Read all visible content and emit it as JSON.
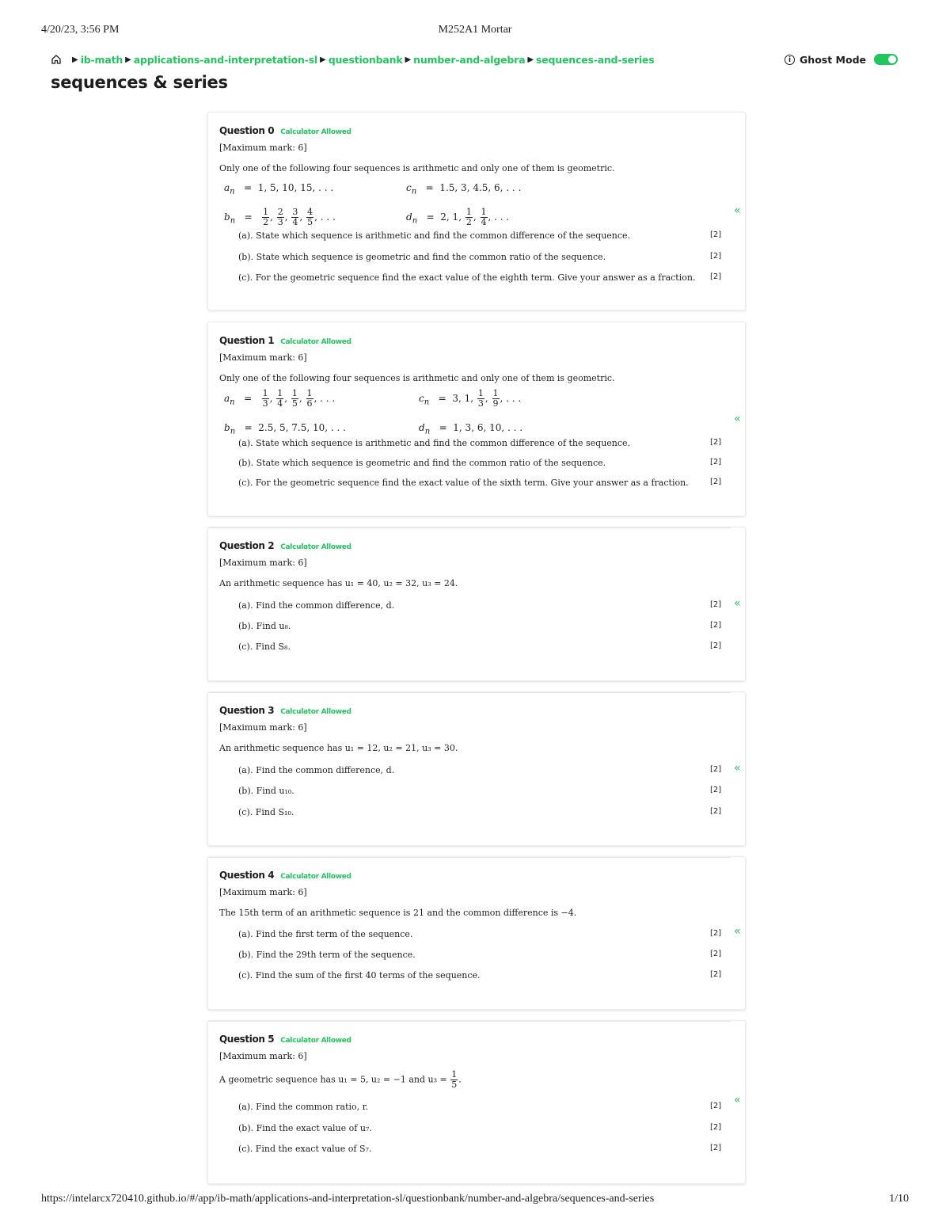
{
  "print": {
    "date": "4/20/23, 3:56 PM",
    "title": "M252A1 Mortar",
    "url": "https://intelarcx720410.github.io/#/app/ib-math/applications-and-interpretation-sl/questionbank/number-and-algebra/sequences-and-series",
    "page": "1/10"
  },
  "nav": {
    "breadcrumbs": [
      "ib-math",
      "applications-and-interpretation-sl",
      "questionbank",
      "number-and-algebra",
      "sequences-and-series"
    ],
    "ghost_label": "Ghost Mode",
    "ghost_on": true,
    "accent": "#22c55e"
  },
  "page_title": "sequences & series",
  "calc_label": "Calculator Allowed",
  "max_mark": "[Maximum mark: 6]",
  "flag_symbol": "[2]",
  "chevron": "«",
  "questions": [
    {
      "title": "Question 0",
      "stem": "Only one of the following four sequences is arithmetic and only one of them is geometric.",
      "parts": [
        "(a). State which sequence is arithmetic and find the common difference of the sequence.",
        "(b). State which sequence is geometric and find the common ratio of the sequence.",
        "(c). For the geometric sequence find the exact value of the eighth term. Give your answer as a fraction."
      ]
    },
    {
      "title": "Question 1",
      "stem": "Only one of the following four sequences is arithmetic and only one of them is geometric.",
      "parts": [
        "(a). State which sequence is arithmetic and find the common difference of the sequence.",
        "(b). State which sequence is geometric and find the common ratio of the sequence.",
        "(c). For the geometric sequence find the exact value of the sixth term. Give your answer as a fraction."
      ]
    },
    {
      "title": "Question 2",
      "stem": "An arithmetic sequence has u₁ = 40, u₂ = 32, u₃ = 24.",
      "parts": [
        "(a). Find the common difference, d.",
        "(b). Find u₈.",
        "(c). Find S₈."
      ]
    },
    {
      "title": "Question 3",
      "stem": "An arithmetic sequence has u₁ = 12, u₂ = 21, u₃ = 30.",
      "parts": [
        "(a). Find the common difference, d.",
        "(b). Find u₁₀.",
        "(c). Find S₁₀."
      ]
    },
    {
      "title": "Question 4",
      "stem": "The 15th term of an arithmetic sequence is 21 and the common difference is −4.",
      "parts": [
        "(a). Find the first term of the sequence.",
        "(b). Find the 29th term of the sequence.",
        "(c). Find the sum of the first 40 terms of the sequence."
      ]
    },
    {
      "title": "Question 5",
      "stem": "A geometric sequence has u₁ = 5, u₂ = −1 and u₃ =",
      "parts": [
        "(a). Find the common ratio, r.",
        "(b). Find the exact value of u₇.",
        "(c). Find the exact value of S₇."
      ]
    }
  ],
  "sequences": {
    "q0": {
      "a": "1, 5, 10, 15, . . .",
      "c": "1.5, 3, 4.5, 6, . . .",
      "b_fracs": [
        [
          "1",
          "2"
        ],
        [
          "2",
          "3"
        ],
        [
          "3",
          "4"
        ],
        [
          "4",
          "5"
        ]
      ],
      "d_lead": "2, 1,",
      "d_fracs": [
        [
          "1",
          "2"
        ],
        [
          "1",
          "4"
        ]
      ]
    },
    "q1": {
      "a_fracs": [
        [
          "1",
          "3"
        ],
        [
          "1",
          "4"
        ],
        [
          "1",
          "5"
        ],
        [
          "1",
          "6"
        ]
      ],
      "c_lead": "3, 1,",
      "c_fracs": [
        [
          "1",
          "3"
        ],
        [
          "1",
          "9"
        ]
      ],
      "b": "2.5, 5, 7.5, 10, . . .",
      "d": "1, 3, 6, 10, . . ."
    },
    "q5_frac": [
      "1",
      "5"
    ]
  },
  "symbols": {
    "a_n": "a",
    "b_n": "b",
    "c_n": "c",
    "d_n": "d",
    "sub_n": "n",
    "eq": "=",
    "ellipsis": ", . . .",
    "comma": ","
  }
}
